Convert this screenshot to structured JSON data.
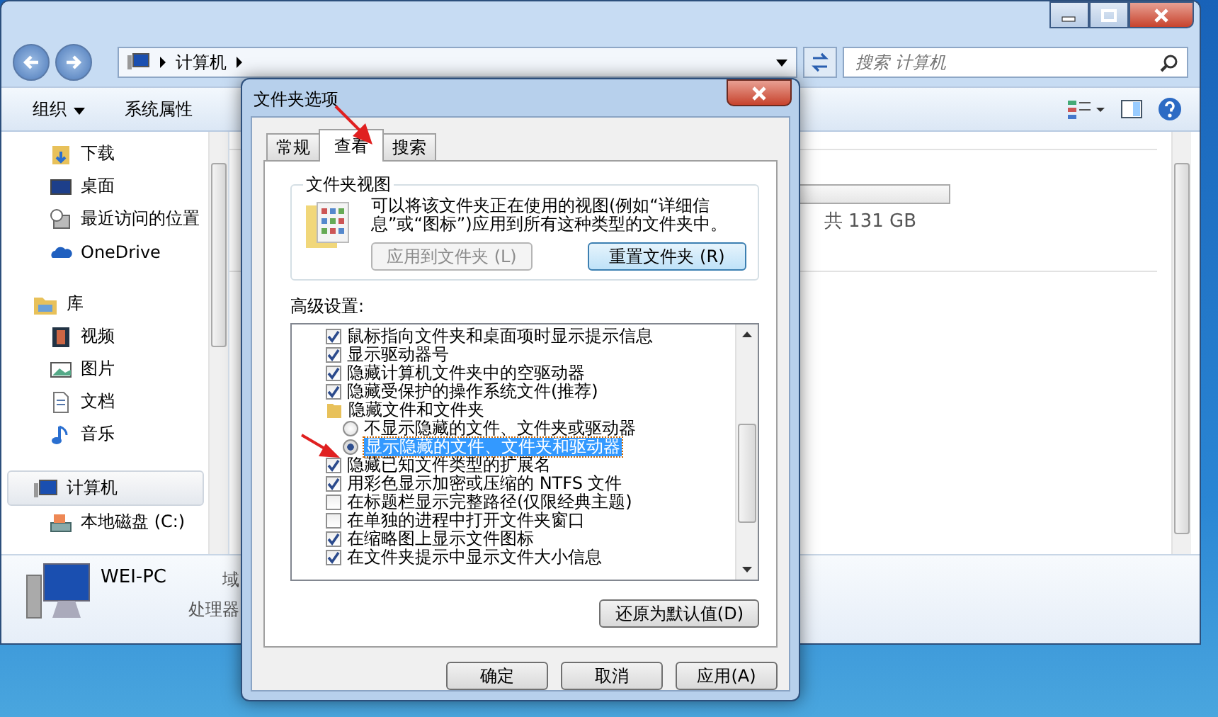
{
  "explorer": {
    "address": {
      "crumbs": [
        "计算机"
      ]
    },
    "search": {
      "placeholder": "搜索 计算机"
    },
    "toolbar": [
      "组织",
      "系统属性"
    ],
    "nav": [
      {
        "label": "下载",
        "selected": false
      },
      {
        "label": "桌面",
        "selected": false
      },
      {
        "label": "最近访问的位置",
        "selected": false
      },
      {
        "label": "OneDrive",
        "selected": false
      },
      {
        "label": "库",
        "selected": false,
        "children": [
          {
            "label": "视频",
            "selected": false
          },
          {
            "label": "图片",
            "selected": false
          },
          {
            "label": "文档",
            "selected": false
          },
          {
            "label": "音乐",
            "selected": false
          }
        ]
      },
      {
        "label": "计算机",
        "selected": true,
        "children": [
          {
            "label": "本地磁盘 (C:)",
            "selected": false
          }
        ]
      }
    ],
    "drive_size": "共 131 GB",
    "details": {
      "name": "WEI-PC",
      "field_1": "域",
      "field_2": "处理器"
    }
  },
  "dialog": {
    "title": "文件夹选项",
    "tabs": [
      {
        "label": "常规",
        "selected": false
      },
      {
        "label": "查看",
        "selected": true
      },
      {
        "label": "搜索",
        "selected": false
      }
    ],
    "folder_views": {
      "title": "文件夹视图",
      "text": "可以将该文件夹正在使用的视图(例如“详细信息”或“图标”)应用到所有这种类型的文件夹中。",
      "buttons": [
        {
          "label": "应用到文件夹 (L)",
          "disabled": true
        },
        {
          "label": "重置文件夹 (R)",
          "disabled": false
        }
      ]
    },
    "advanced_label": "高级设置:",
    "settings": [
      {
        "kind": "checkbox",
        "label": "鼠标指向文件夹和桌面项时显示提示信息",
        "checked": true
      },
      {
        "kind": "checkbox",
        "label": "显示驱动器号",
        "checked": true
      },
      {
        "kind": "checkbox",
        "label": "隐藏计算机文件夹中的空驱动器",
        "checked": true
      },
      {
        "kind": "checkbox",
        "label": "隐藏受保护的操作系统文件(推荐)",
        "checked": true
      },
      {
        "kind": "folder",
        "label": "隐藏文件和文件夹",
        "children": [
          {
            "kind": "radio",
            "label": "不显示隐藏的文件、文件夹或驱动器",
            "selected": false
          },
          {
            "kind": "radio",
            "label": "显示隐藏的文件、文件夹和驱动器",
            "selected": true
          }
        ]
      },
      {
        "kind": "checkbox",
        "label": "隐藏已知文件类型的扩展名",
        "checked": true
      },
      {
        "kind": "checkbox",
        "label": "用彩色显示加密或压缩的 NTFS 文件",
        "checked": true
      },
      {
        "kind": "checkbox",
        "label": "在标题栏显示完整路径(仅限经典主题)",
        "checked": false
      },
      {
        "kind": "checkbox",
        "label": "在单独的进程中打开文件夹窗口",
        "checked": false
      },
      {
        "kind": "checkbox",
        "label": "在缩略图上显示文件图标",
        "checked": true
      },
      {
        "kind": "checkbox",
        "label": "在文件夹提示中显示文件大小信息",
        "checked": true
      }
    ],
    "restore_button": "还原为默认值(D)",
    "buttons": [
      "确定",
      "取消",
      "应用(A)"
    ]
  }
}
